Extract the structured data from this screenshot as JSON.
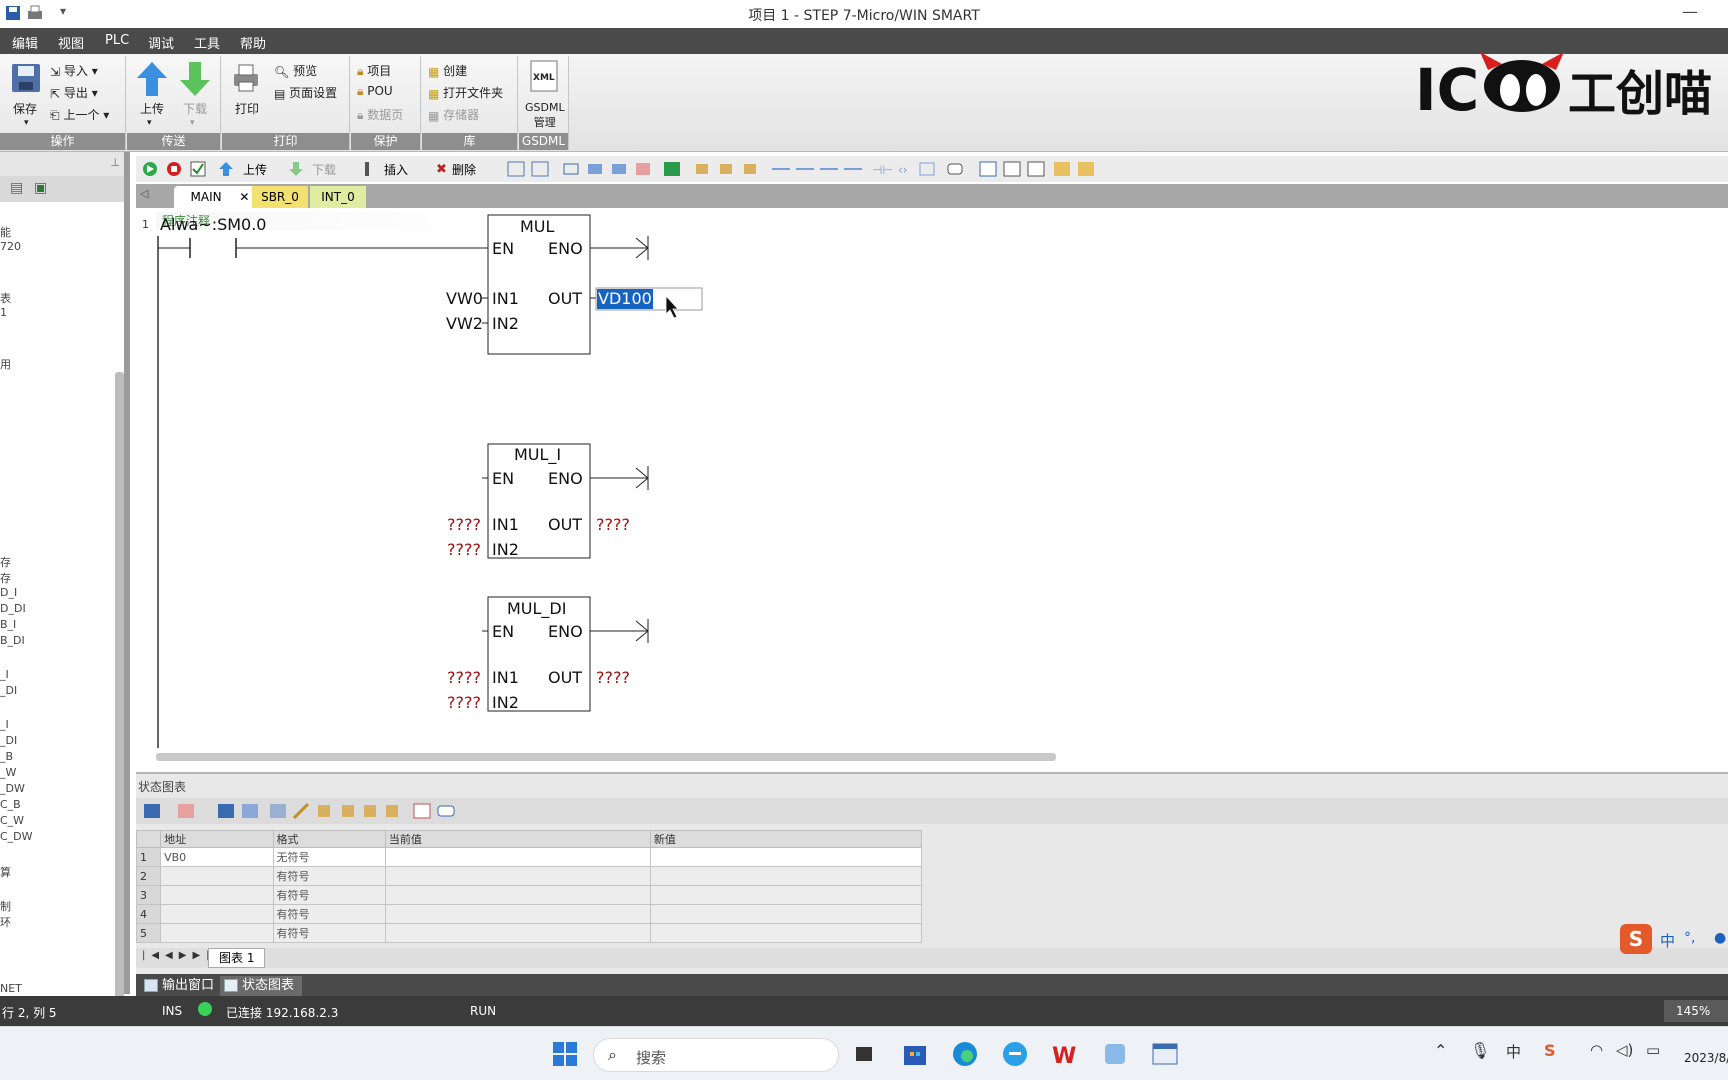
{
  "window": {
    "title": "项目 1 - STEP 7-Micro/WIN SMART",
    "minimize": "—"
  },
  "menu": [
    "编辑",
    "视图",
    "PLC",
    "调试",
    "工具",
    "帮助"
  ],
  "ribbon": {
    "groups": {
      "operate": "操作",
      "transfer": "传送",
      "print": "打印",
      "protect": "保护",
      "library": "库",
      "gsdml": "GSDML"
    },
    "save": "保存",
    "import": "导入",
    "export": "导出",
    "prev": "上一个",
    "upload": "上传",
    "download": "下载",
    "print": "打印",
    "preview": "预览",
    "page_setup": "页面设置",
    "project": "项目",
    "pou": "POU",
    "data_page": "数据页",
    "create": "创建",
    "open_folder": "打开文件夹",
    "memory": "存储器",
    "gsdml_manage": "GSDML\n管理"
  },
  "logo": {
    "text_cn": "工创喵",
    "text_en": "IC"
  },
  "left_panel": {
    "fragments": [
      "能",
      "720",
      "表",
      "1",
      "用",
      "存",
      "存",
      "D_I",
      "D_DI",
      "B_I",
      "B_DI",
      "_I",
      "_DI",
      "_I",
      "_DI",
      "_B",
      "_W",
      "_DW",
      "C_B",
      "C_W",
      "C_DW",
      "算",
      "制",
      "环",
      "NET"
    ]
  },
  "editor": {
    "toolbar": {
      "upload": "上传",
      "download": "下载",
      "insert": "插入",
      "delete": "删除"
    },
    "tabs": [
      "MAIN",
      "SBR_0",
      "INT_0"
    ],
    "program_comment": "程序注释",
    "network_number": "1",
    "contact_label": "Alwa~:SM0.0",
    "boxes": [
      {
        "name": "MUL",
        "en": "EN",
        "eno": "ENO",
        "in1_label": "IN1",
        "in2_label": "IN2",
        "out_label": "OUT",
        "in1": "VW0",
        "in2": "VW2",
        "out": "VD100"
      },
      {
        "name": "MUL_I",
        "en": "EN",
        "eno": "ENO",
        "in1_label": "IN1",
        "in2_label": "IN2",
        "out_label": "OUT",
        "in1": "????",
        "in2": "????",
        "out": "????"
      },
      {
        "name": "MUL_DI",
        "en": "EN",
        "eno": "ENO",
        "in1_label": "IN1",
        "in2_label": "IN2",
        "out_label": "OUT",
        "in1": "????",
        "in2": "????",
        "out": "????"
      }
    ]
  },
  "status_chart": {
    "title": "状态图表",
    "columns": [
      "地址",
      "格式",
      "当前值",
      "新值"
    ],
    "rows": [
      {
        "idx": "1",
        "address": "VB0",
        "format": "无符号",
        "current": "",
        "new": ""
      },
      {
        "idx": "2",
        "address": "",
        "format": "有符号",
        "current": "",
        "new": ""
      },
      {
        "idx": "3",
        "address": "",
        "format": "有符号",
        "current": "",
        "new": ""
      },
      {
        "idx": "4",
        "address": "",
        "format": "有符号",
        "current": "",
        "new": ""
      },
      {
        "idx": "5",
        "address": "",
        "format": "有符号",
        "current": "",
        "new": ""
      }
    ],
    "sheet_tab": "图表 1"
  },
  "bottom_tabs": [
    "输出窗口",
    "状态图表"
  ],
  "status_bar": {
    "position": "行 2, 列 5",
    "mode": "INS",
    "connection": "已连接 192.168.2.3",
    "run": "RUN",
    "zoom": "145%"
  },
  "ime": {
    "lang": "中",
    "punct": "°,"
  },
  "taskbar": {
    "search": "搜索",
    "date": "2023/8/"
  },
  "colors": {
    "menu_bg": "#4a4a4a",
    "group_label_bg": "#8e8e8e",
    "highlight": "#1565c0",
    "tab_active": "#ffffff",
    "tab_sbr": "#f2e070",
    "tab_int": "#e0eca0",
    "unknown_operand": "#a01010"
  }
}
